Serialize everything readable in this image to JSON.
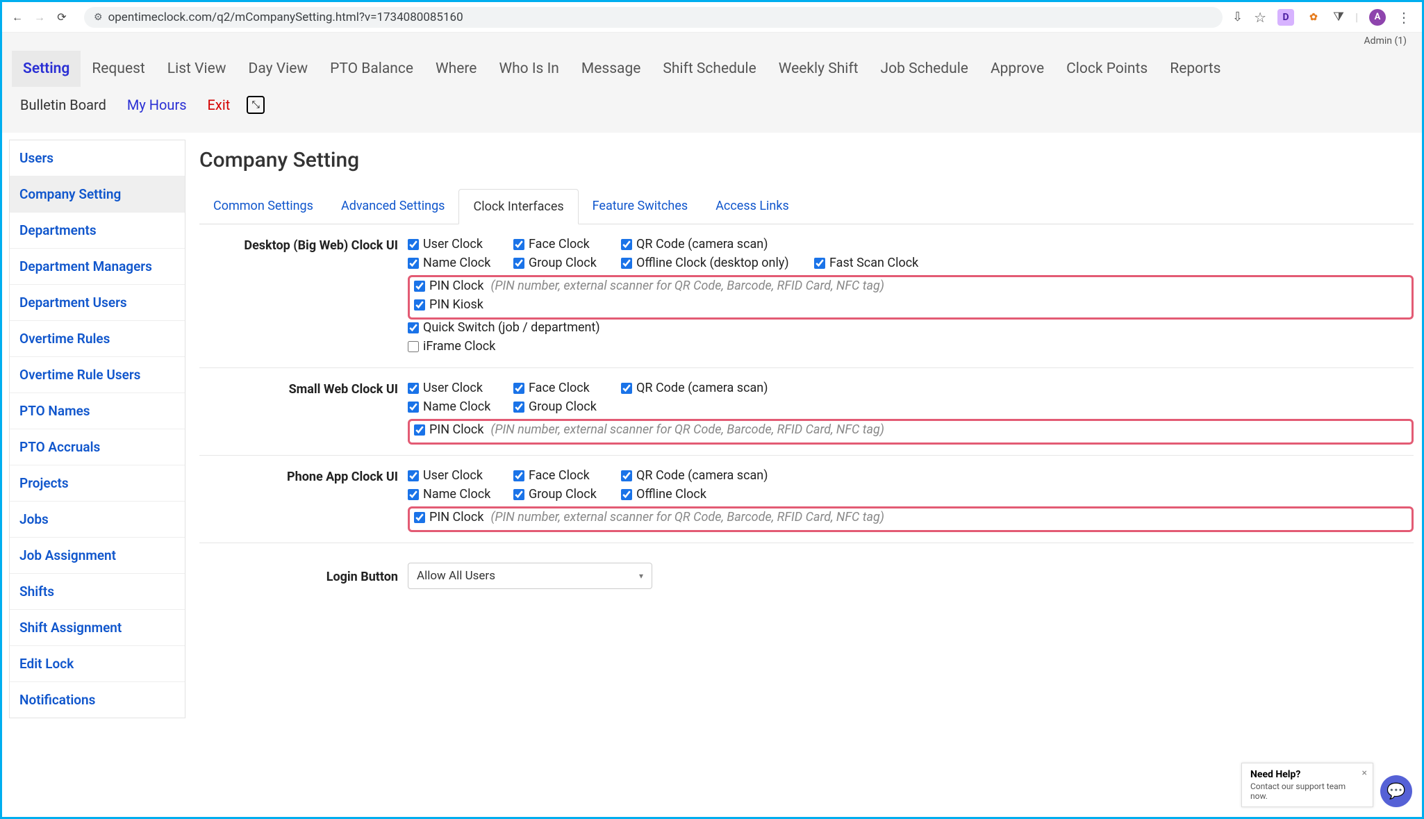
{
  "browser": {
    "url": "opentimeclock.com/q2/mCompanySetting.html?v=1734080085160",
    "avatar_letter": "A",
    "ext_d_label": "D"
  },
  "header": {
    "admin_label": "Admin (1)",
    "nav": [
      "Setting",
      "Request",
      "List View",
      "Day View",
      "PTO Balance",
      "Where",
      "Who Is In",
      "Message",
      "Shift Schedule",
      "Weekly Shift",
      "Job Schedule",
      "Approve",
      "Clock Points",
      "Reports"
    ],
    "nav2_bulletin": "Bulletin Board",
    "nav2_myhours": "My Hours",
    "nav2_exit": "Exit"
  },
  "sidebar": {
    "items": [
      "Users",
      "Company Setting",
      "Departments",
      "Department Managers",
      "Department Users",
      "Overtime Rules",
      "Overtime Rule Users",
      "PTO Names",
      "PTO Accruals",
      "Projects",
      "Jobs",
      "Job Assignment",
      "Shifts",
      "Shift Assignment",
      "Edit Lock",
      "Notifications"
    ]
  },
  "page": {
    "title": "Company Setting",
    "tabs": [
      "Common Settings",
      "Advanced Settings",
      "Clock Interfaces",
      "Feature Switches",
      "Access Links"
    ]
  },
  "sections": {
    "desktop": {
      "label": "Desktop (Big Web) Clock UI",
      "row1": {
        "user": "User Clock",
        "face": "Face Clock",
        "qr": "QR Code (camera scan)"
      },
      "row2": {
        "name": "Name Clock",
        "group": "Group Clock",
        "offline": "Offline Clock (desktop only)",
        "fast": "Fast Scan Clock"
      },
      "pin_label": "PIN Clock",
      "pin_hint": "(PIN number, external scanner for QR Code, Barcode, RFID Card, NFC tag)",
      "pin_kiosk": "PIN Kiosk",
      "quick_switch": "Quick Switch (job / department)",
      "iframe": "iFrame Clock"
    },
    "small": {
      "label": "Small Web Clock UI",
      "row1": {
        "user": "User Clock",
        "face": "Face Clock",
        "qr": "QR Code (camera scan)"
      },
      "row2": {
        "name": "Name Clock",
        "group": "Group Clock"
      },
      "pin_label": "PIN Clock",
      "pin_hint": "(PIN number, external scanner for QR Code, Barcode, RFID Card, NFC tag)"
    },
    "phone": {
      "label": "Phone App Clock UI",
      "row1": {
        "user": "User Clock",
        "face": "Face Clock",
        "qr": "QR Code (camera scan)"
      },
      "row2": {
        "name": "Name Clock",
        "group": "Group Clock",
        "offline": "Offline Clock"
      },
      "pin_label": "PIN Clock",
      "pin_hint": "(PIN number, external scanner for QR Code, Barcode, RFID Card, NFC tag)"
    },
    "login": {
      "label": "Login Button",
      "selected": "Allow All Users"
    }
  },
  "help": {
    "title": "Need Help?",
    "sub": "Contact our support team now."
  }
}
